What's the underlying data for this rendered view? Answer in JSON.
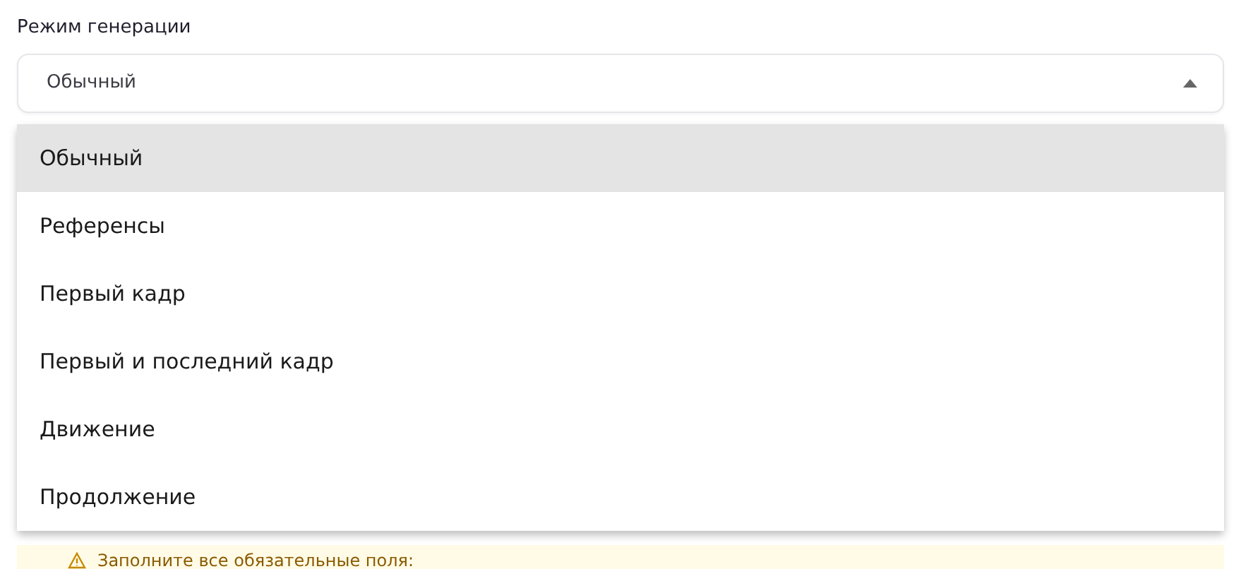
{
  "field": {
    "label": "Режим генерации",
    "value": "Обычный",
    "expanded": true
  },
  "options": [
    {
      "label": "Обычный",
      "selected": true
    },
    {
      "label": "Референсы",
      "selected": false
    },
    {
      "label": "Первый кадр",
      "selected": false
    },
    {
      "label": "Первый и последний кадр",
      "selected": false
    },
    {
      "label": "Движение",
      "selected": false
    },
    {
      "label": "Продолжение",
      "selected": false
    }
  ],
  "warning": {
    "text": "Заполните все обязательные поля:"
  }
}
